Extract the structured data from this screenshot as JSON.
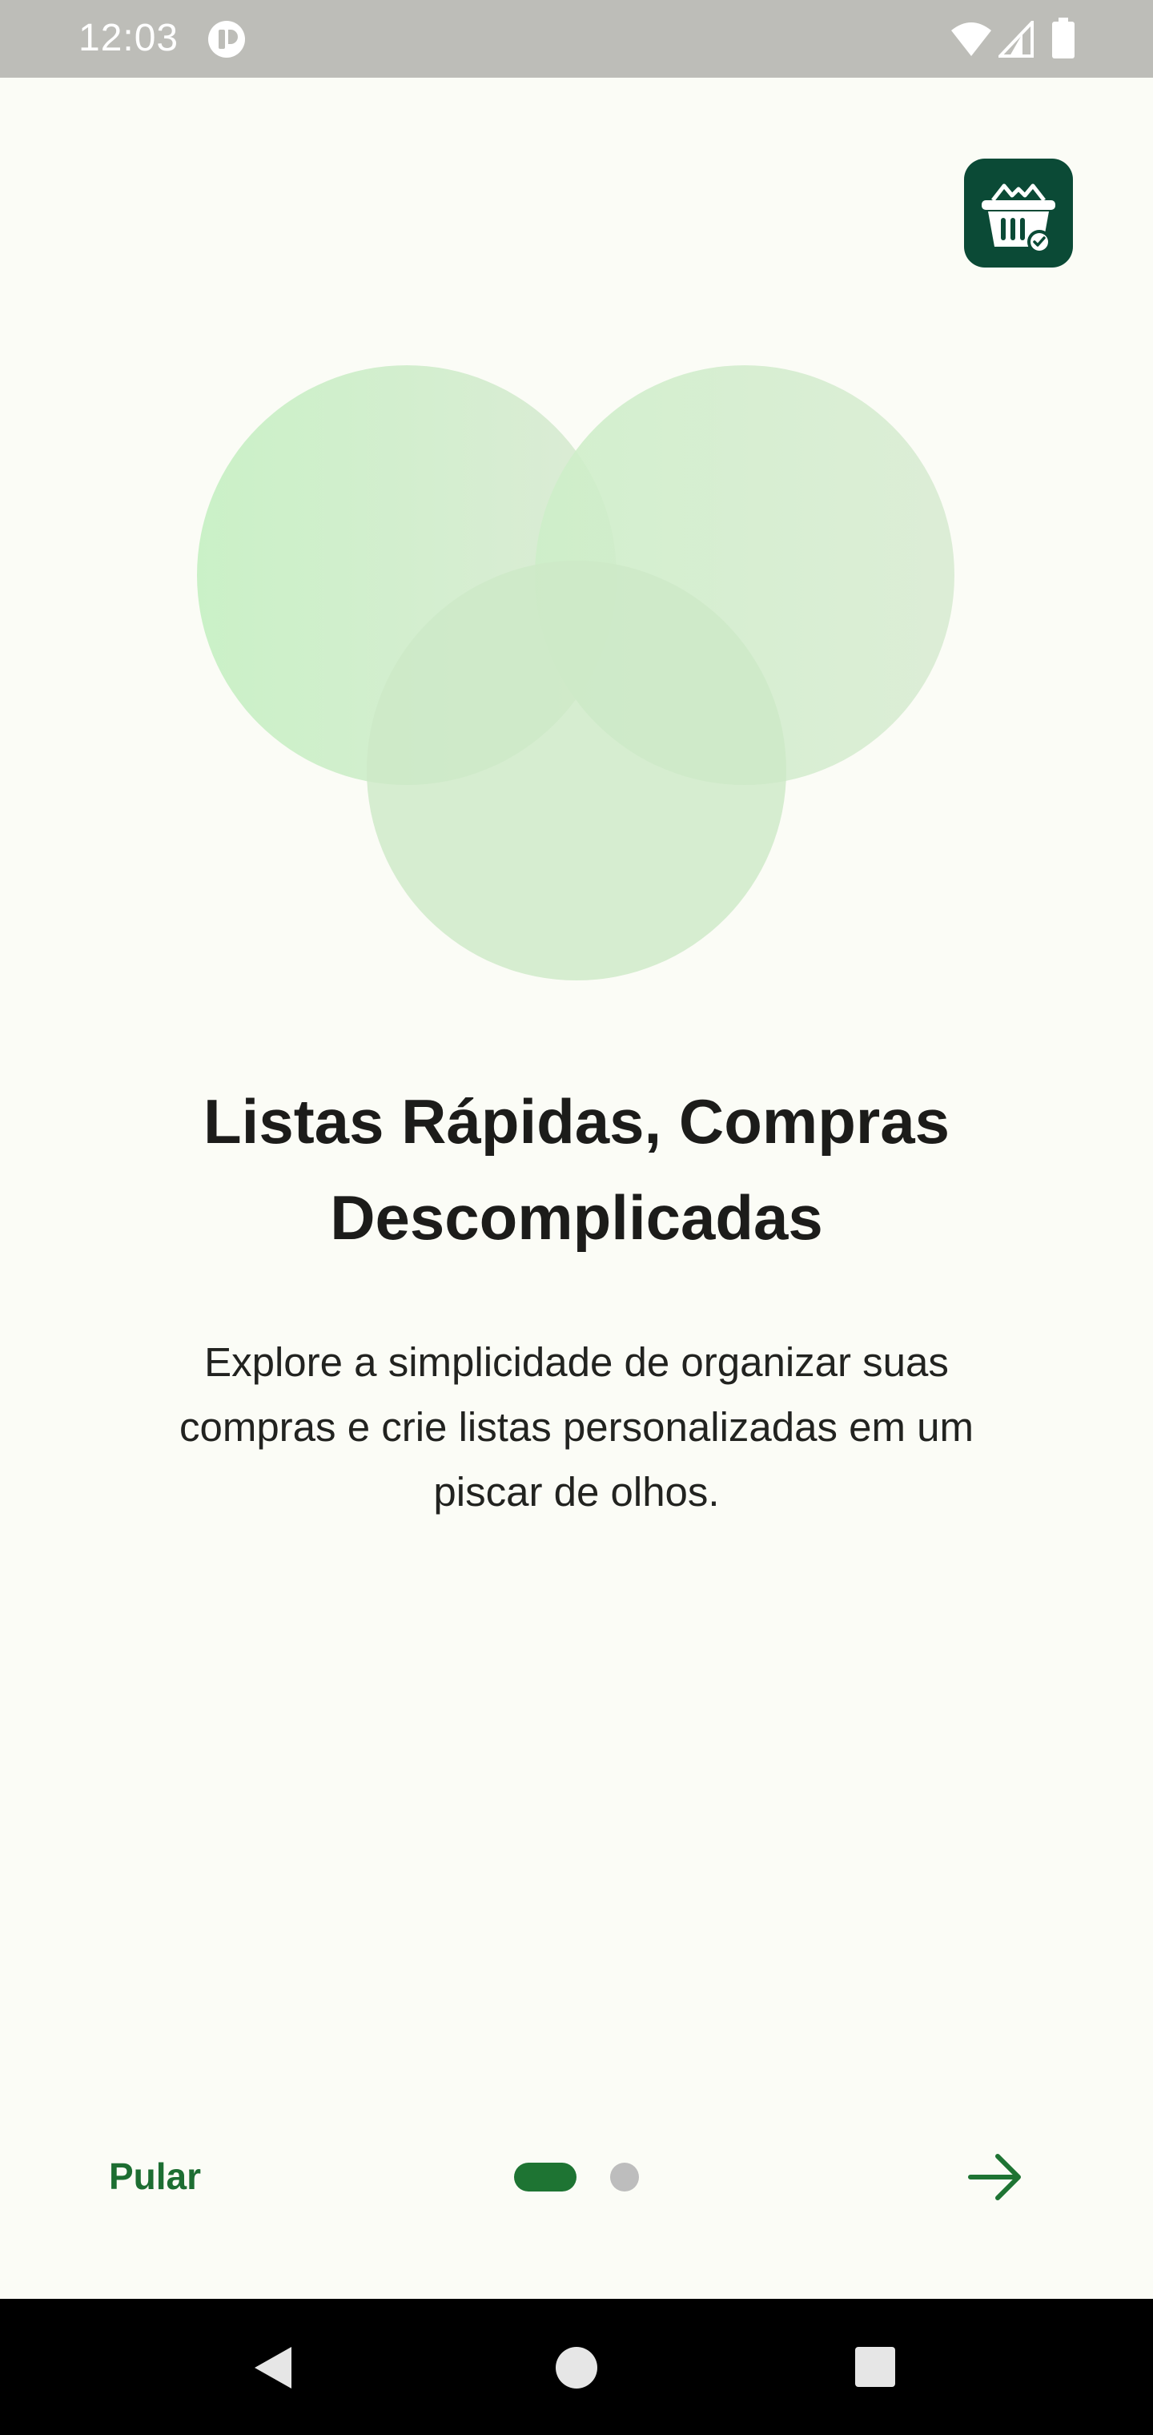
{
  "status_bar": {
    "time": "12:03"
  },
  "onboarding": {
    "title_line1": "Listas Rápidas, Compras",
    "title_line2": "Descomplicadas",
    "description_line1": "Explore a simplicidade de organizar suas",
    "description_line2": "compras e crie listas personalizadas em um",
    "description_line3": "piscar de olhos.",
    "current_page": 1,
    "total_pages": 2
  },
  "footer": {
    "skip_label": "Pular"
  },
  "colors": {
    "accent": "#1e7433",
    "logo_background": "#0b4a36",
    "background": "#fbfcf6",
    "circle_fill": "#cdebc9",
    "inactive_dot": "#bdbdbd"
  },
  "icons": {
    "logo": "shopping-basket-check-icon",
    "next": "arrow-right-icon",
    "nav_back": "triangle-back-icon",
    "nav_home": "circle-home-icon",
    "nav_recents": "square-recents-icon"
  }
}
